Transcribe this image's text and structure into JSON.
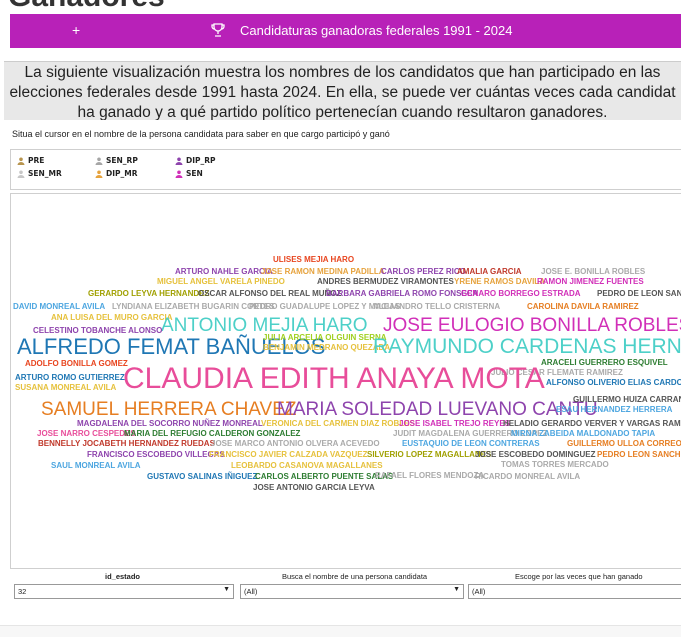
{
  "top_peek": "Ganadores",
  "header": {
    "plus": "+",
    "title": "Candidaturas ganadoras federales 1991 - 2024",
    "bg_color": "#b821b8"
  },
  "intro": {
    "lines": [
      "La siguiente visualización muestra los nombres de los candidatos que han participado en las",
      "elecciones federales desde 1991 hasta 2024. En ella, se puede ver cuántas veces cada candidat",
      "ha ganado y a qué partido político pertenecían cuando resultaron ganadores."
    ]
  },
  "hint": "Situa el cursor en el nombre de la persona candidata para saber en que cargo participó y ganó",
  "legend": [
    {
      "label": "PRE",
      "color": "#b8954f"
    },
    {
      "label": "SEN_RP",
      "color": "#a6a6a6"
    },
    {
      "label": "DIP_RP",
      "color": "#8e44ad"
    },
    {
      "label": "SEN_MR",
      "color": "#c7c7c7"
    },
    {
      "label": "DIP_MR",
      "color": "#e6a23c"
    },
    {
      "label": "SEN",
      "color": "#d12fb8"
    }
  ],
  "words": [
    {
      "text": "ULISES MEJIA HARO",
      "color": "#e8451f",
      "size": 8
    },
    {
      "text": "ARTURO NAHLE GARCIA",
      "color": "#8e44ad",
      "size": 8
    },
    {
      "text": "JOSE RAMON MEDINA PADILLA",
      "color": "#e6a23c",
      "size": 8
    },
    {
      "text": "CARLOS PEREZ RICO",
      "color": "#8e44ad",
      "size": 8
    },
    {
      "text": "AMALIA GARCIA",
      "color": "#c0392b",
      "size": 8
    },
    {
      "text": "JOSE E. BONILLA ROBLES",
      "color": "#aaaaaa",
      "size": 8
    },
    {
      "text": "MIGUEL ANGEL VARELA PINEDO",
      "color": "#e6c13c",
      "size": 8
    },
    {
      "text": "ANDRES BERMUDEZ VIRAMONTES",
      "color": "#555555",
      "size": 8
    },
    {
      "text": "YRENE RAMOS DAVILA",
      "color": "#e6a23c",
      "size": 8
    },
    {
      "text": "RAMON JIMENEZ FUENTES",
      "color": "#d12fb8",
      "size": 8
    },
    {
      "text": "GERARDO LEYVA HERNANDEZ",
      "color": "#a0a000",
      "size": 8
    },
    {
      "text": "OSCAR ALFONSO DEL REAL MUÑOZ",
      "color": "#555555",
      "size": 8
    },
    {
      "text": "BARBARA GABRIELA ROMO FONSECA",
      "color": "#8e44ad",
      "size": 8
    },
    {
      "text": "GENARO BORREGO ESTRADA",
      "color": "#d12fb8",
      "size": 8
    },
    {
      "text": "PEDRO DE LEON SANCHEZ",
      "color": "#555555",
      "size": 8
    },
    {
      "text": "DAVID MONREAL AVILA",
      "color": "#4da6e0",
      "size": 8
    },
    {
      "text": "LYNDIANA ELIZABETH BUGARIN CORTES",
      "color": "#aaaaaa",
      "size": 8
    },
    {
      "text": "PEDRO GUADALUPE LOPEZ Y MACIAS",
      "color": "#aaaaaa",
      "size": 8
    },
    {
      "text": "ALEJANDRO TELLO CRISTERNA",
      "color": "#aaaaaa",
      "size": 8
    },
    {
      "text": "CAROLINA DAVILA RAMIREZ",
      "color": "#e67e22",
      "size": 8
    },
    {
      "text": "ANA LUISA DEL MURO GARCIA",
      "color": "#e6c13c",
      "size": 8
    },
    {
      "text": "ANTONIO MEJIA HARO",
      "color": "#4dd0c8",
      "size": 19
    },
    {
      "text": "JOSE EULOGIO BONILLA ROBLES",
      "color": "#d12fb8",
      "size": 19
    },
    {
      "text": "CELESTINO TOBANCHE ALONSO",
      "color": "#8e44ad",
      "size": 8
    },
    {
      "text": "ALFREDO FEMAT BAÑUELOS",
      "color": "#1f77b4",
      "size": 22
    },
    {
      "text": "JULIA ARCELIA OLGUIN SERNA",
      "color": "#a0d020",
      "size": 8
    },
    {
      "text": "BENJAMIN MEDRANO QUEZADA",
      "color": "#e6c13c",
      "size": 8
    },
    {
      "text": "RAYMUNDO CARDENAS HERNANDEZ",
      "color": "#4dd0c8",
      "size": 21
    },
    {
      "text": "ADOLFO BONILLA GOMEZ",
      "color": "#e8451f",
      "size": 8
    },
    {
      "text": "ARACELI GUERRERO ESQUIVEL",
      "color": "#2e7d32",
      "size": 8
    },
    {
      "text": "JULIO CESAR FLEMATE RAMIREZ",
      "color": "#aaaaaa",
      "size": 8
    },
    {
      "text": "ARTURO ROMO GUTIERREZ",
      "color": "#1f77b4",
      "size": 8
    },
    {
      "text": "CLAUDIA EDITH ANAYA MOTA",
      "color": "#e84d9a",
      "size": 30
    },
    {
      "text": "ALFONSO OLIVERIO ELIAS CARDONA",
      "color": "#1f77b4",
      "size": 8
    },
    {
      "text": "SUSANA MONREAL AVILA",
      "color": "#e6c13c",
      "size": 8
    },
    {
      "text": "SAMUEL HERRERA CHAVEZ",
      "color": "#e67e22",
      "size": 19
    },
    {
      "text": "MARIA SOLEDAD LUEVANO CANTU",
      "color": "#8e44ad",
      "size": 19
    },
    {
      "text": "GUILLERMO HUIZA CARRANZA",
      "color": "#555555",
      "size": 8
    },
    {
      "text": "ESAU HERNANDEZ HERRERA",
      "color": "#4da6e0",
      "size": 8
    },
    {
      "text": "MAGDALENA DEL SOCORRO NUÑEZ MONREAL",
      "color": "#8e44ad",
      "size": 8
    },
    {
      "text": "VERONICA DEL CARMEN DIAZ ROBLES",
      "color": "#e6c13c",
      "size": 8
    },
    {
      "text": "JOSE ISABEL TREJO REYES",
      "color": "#d12fb8",
      "size": 8
    },
    {
      "text": "HELADIO GERARDO VERVER Y VARGAS RAMIREZ",
      "color": "#555555",
      "size": 8
    },
    {
      "text": "JOSE NARRO CESPEDES",
      "color": "#e84d9a",
      "size": 8
    },
    {
      "text": "MARIA DEL REFUGIO CALDERON GONZALEZ",
      "color": "#2e7d32",
      "size": 8
    },
    {
      "text": "JUDIT MAGDALENA GUERRERO LOPEZ",
      "color": "#aaaaaa",
      "size": 8
    },
    {
      "text": "MIRNA ZABEIDA MALDONADO TAPIA",
      "color": "#4da6e0",
      "size": 8
    },
    {
      "text": "BENNELLY JOCABETH HERNANDEZ RUEDAS",
      "color": "#c0392b",
      "size": 8
    },
    {
      "text": "JOSE MARCO ANTONIO OLVERA ACEVEDO",
      "color": "#aaaaaa",
      "size": 8
    },
    {
      "text": "EUSTAQUIO DE LEON CONTRERAS",
      "color": "#4da6e0",
      "size": 8
    },
    {
      "text": "GUILLERMO ULLOA CORREON",
      "color": "#e67e22",
      "size": 8
    },
    {
      "text": "FRANCISCO ESCOBEDO VILLEGAS",
      "color": "#8e44ad",
      "size": 8
    },
    {
      "text": "FRANCISCO JAVIER CALZADA VAZQUEZ",
      "color": "#e6c13c",
      "size": 8
    },
    {
      "text": "SILVERIO LOPEZ MAGALLANES",
      "color": "#a0a000",
      "size": 8
    },
    {
      "text": "JOSE ESCOBEDO DOMINGUEZ",
      "color": "#555555",
      "size": 8
    },
    {
      "text": "PEDRO LEON SANCHEZ",
      "color": "#e67e22",
      "size": 8
    },
    {
      "text": "SAUL MONREAL AVILA",
      "color": "#4da6e0",
      "size": 8
    },
    {
      "text": "LEOBARDO CASANOVA MAGALLANES",
      "color": "#e6c13c",
      "size": 8
    },
    {
      "text": "TOMAS TORRES MERCADO",
      "color": "#aaaaaa",
      "size": 8
    },
    {
      "text": "GUSTAVO SALINAS IÑIGUEZ",
      "color": "#1f77b4",
      "size": 8
    },
    {
      "text": "CARLOS ALBERTO PUENTE SALAS",
      "color": "#2e7d32",
      "size": 8
    },
    {
      "text": "RAFAEL FLORES MENDOZA",
      "color": "#aaaaaa",
      "size": 8
    },
    {
      "text": "RICARDO MONREAL AVILA",
      "color": "#aaaaaa",
      "size": 8
    },
    {
      "text": "JOSE ANTONIO GARCIA LEYVA",
      "color": "#555555",
      "size": 8
    }
  ],
  "filters": {
    "estado": {
      "label": "id_estado",
      "value": "32"
    },
    "nombre": {
      "label": "Busca el nombre de una persona candidata",
      "value": "(All)"
    },
    "veces": {
      "label": "Escoge por las veces que han ganado",
      "value": "(All)"
    }
  }
}
